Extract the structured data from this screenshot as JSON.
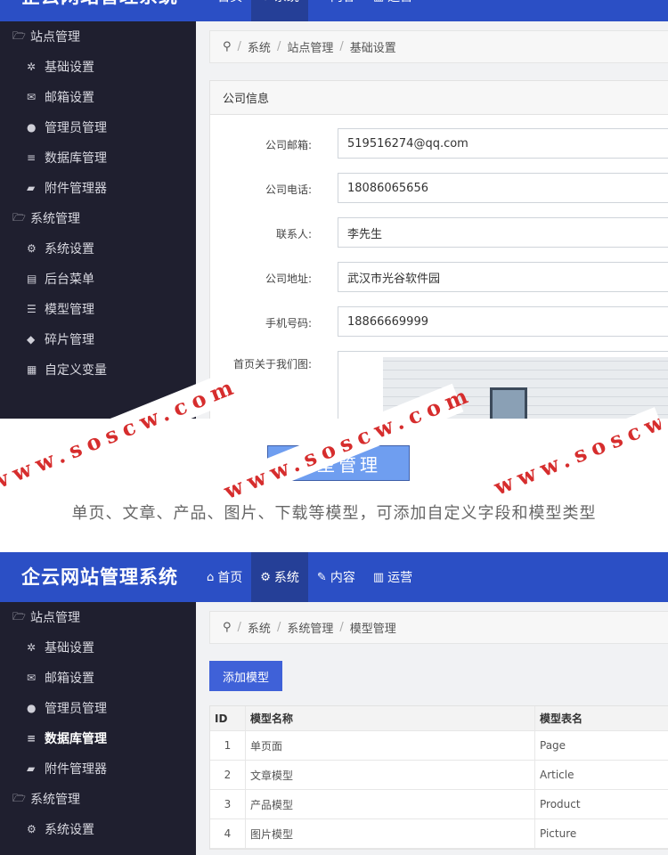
{
  "app": {
    "title": "企云网站管理系统"
  },
  "nav": [
    {
      "label": "首页",
      "icon": "home-icon"
    },
    {
      "label": "系统",
      "icon": "cogs-icon"
    },
    {
      "label": "内容",
      "icon": "edit-icon"
    },
    {
      "label": "运营",
      "icon": "bar-chart-icon"
    }
  ],
  "sidebar": {
    "site_group": "站点管理",
    "system_group": "系统管理",
    "site_items": [
      "基础设置",
      "邮箱设置",
      "管理员管理",
      "数据库管理",
      "附件管理器"
    ],
    "system_items": [
      "系统设置",
      "后台菜单",
      "模型管理",
      "碎片管理",
      "自定义变量"
    ]
  },
  "screen1": {
    "breadcrumb": [
      "系统",
      "站点管理",
      "基础设置"
    ],
    "panel_title": "公司信息",
    "fields": [
      {
        "label": "公司邮箱:",
        "value": "519516274@qq.com"
      },
      {
        "label": "公司电话:",
        "value": "18086065656"
      },
      {
        "label": "联系人:",
        "value": "李先生"
      },
      {
        "label": "公司地址:",
        "value": "武汉市光谷软件园"
      },
      {
        "label": "手机号码:",
        "value": "18866669999"
      }
    ],
    "image_label": "首页关于我们图:"
  },
  "caption": {
    "button": "模型管理",
    "text": "单页、文章、产品、图片、下载等模型，可添加自定义字段和模型类型"
  },
  "watermark": "www.soscw.com",
  "screen2": {
    "breadcrumb": [
      "系统",
      "系统管理",
      "模型管理"
    ],
    "add_button": "添加模型",
    "table": {
      "headers": [
        "ID",
        "模型名称",
        "模型表名"
      ],
      "rows": [
        [
          "1",
          "单页面",
          "Page"
        ],
        [
          "2",
          "文章模型",
          "Article"
        ],
        [
          "3",
          "产品模型",
          "Product"
        ],
        [
          "4",
          "图片模型",
          "Picture"
        ]
      ]
    }
  },
  "colors": {
    "header": "#2b4fc5",
    "sidebar": "#1f1f2f",
    "watermark": "#d62d2d",
    "caption_button": "#6f9ef0"
  }
}
